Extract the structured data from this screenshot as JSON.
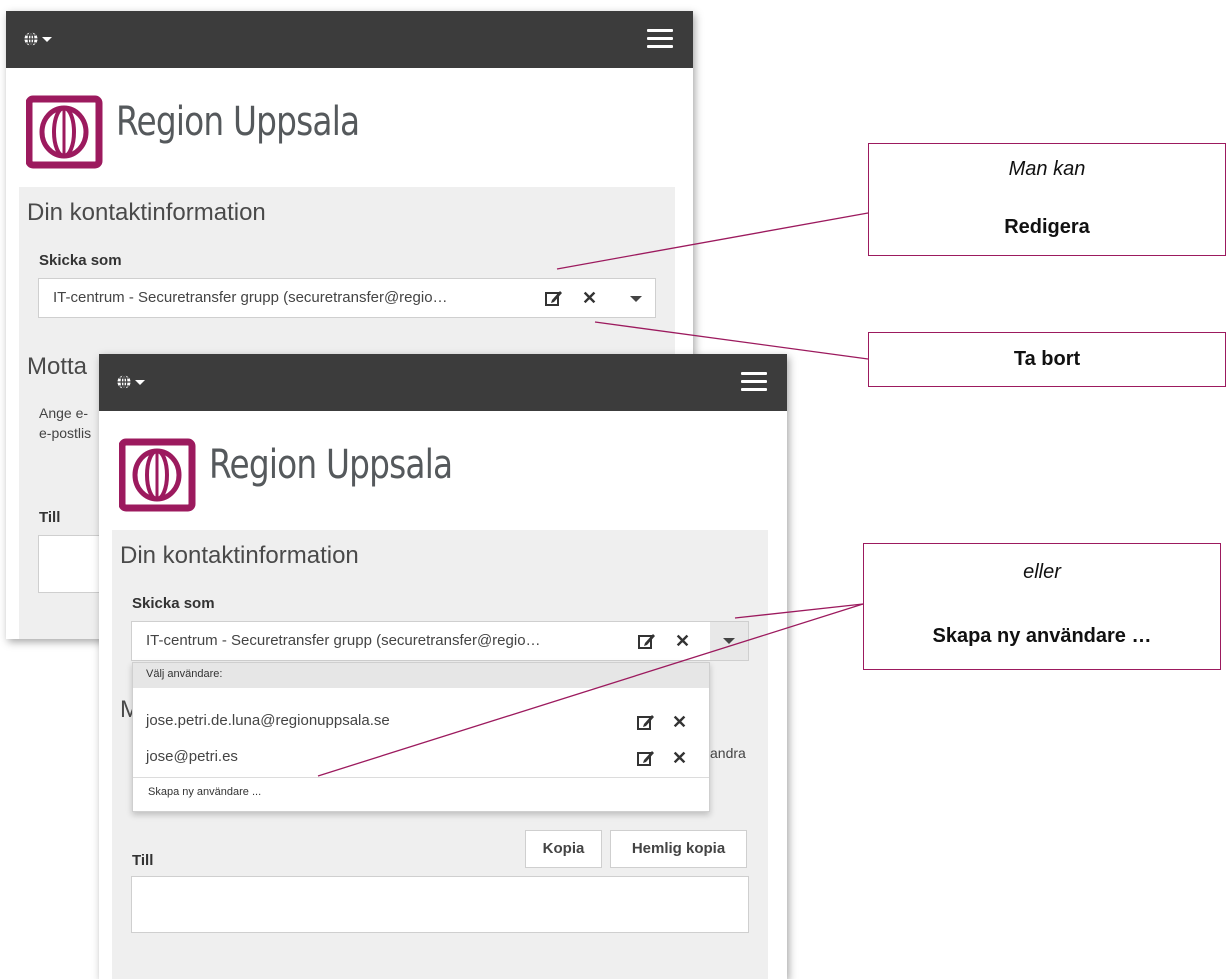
{
  "brand": {
    "name": "Region Uppsala",
    "logo_color": "#9c1a5e"
  },
  "section_title": "Din kontaktinformation",
  "send_as": {
    "label": "Skicka som",
    "selected_value": "IT-centrum - Securetransfer grupp (securetransfer@regio…"
  },
  "back_window": {
    "recipients_title_partial": "Motta",
    "help_line1_partial": "Ange e-",
    "help_line2_partial": "e-postlis",
    "to_label": "Till"
  },
  "dropdown": {
    "header": "Välj användare:",
    "items": [
      {
        "label": "jose.petri.de.luna@regionuppsala.se"
      },
      {
        "label": "jose@petri.es"
      }
    ],
    "create_new": "Skapa ny användare ..."
  },
  "front_window": {
    "heading_partial": "M",
    "help_partial_a": "A",
    "help_partial_b": "andra",
    "copy_button": "Kopia",
    "bcc_button": "Hemlig kopia",
    "to_label": "Till"
  },
  "icons": [
    "globe-icon",
    "caret-down-icon",
    "menu-icon",
    "edit-icon",
    "close-icon"
  ],
  "callouts": {
    "edit": {
      "italic": "Man kan",
      "bold": "Redigera"
    },
    "delete": {
      "bold": "Ta bort"
    },
    "create": {
      "italic": "eller",
      "bold": "Skapa ny användare …"
    }
  },
  "accent_color": "#9c1a5e"
}
